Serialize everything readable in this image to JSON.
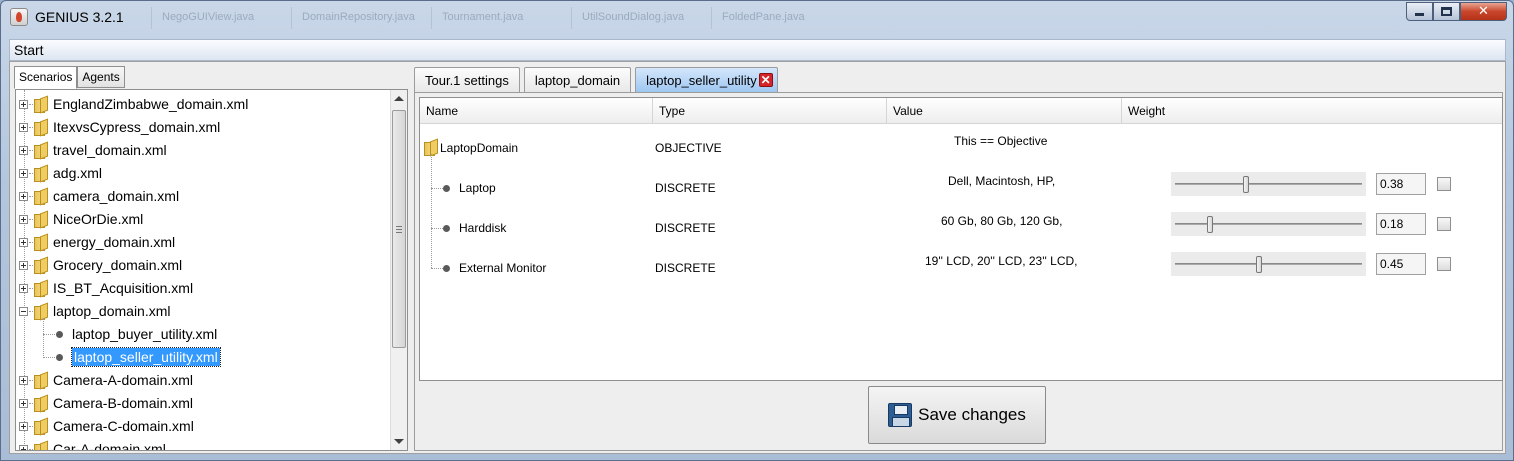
{
  "window": {
    "title": "GENIUS 3.2.1",
    "background_tabs": [
      "NegoGUIView.java",
      "DomainRepository.java",
      "Tournament.java",
      "UtilSoundDialog.java",
      "FoldedPane.java"
    ],
    "buttons": {
      "minimize": "minimize-icon",
      "maximize": "maximize-icon",
      "close": "✕"
    }
  },
  "menubar": {
    "start": "Start"
  },
  "left": {
    "tabs": [
      "Scenarios",
      "Agents"
    ],
    "active_tab": "Scenarios",
    "tree": [
      {
        "label": "EnglandZimbabwe_domain.xml",
        "expanded": false
      },
      {
        "label": "ItexvsCypress_domain.xml",
        "expanded": false
      },
      {
        "label": "travel_domain.xml",
        "expanded": false
      },
      {
        "label": "adg.xml",
        "expanded": false
      },
      {
        "label": "camera_domain.xml",
        "expanded": false
      },
      {
        "label": "NiceOrDie.xml",
        "expanded": false
      },
      {
        "label": "energy_domain.xml",
        "expanded": false
      },
      {
        "label": "Grocery_domain.xml",
        "expanded": false
      },
      {
        "label": "IS_BT_Acquisition.xml",
        "expanded": false
      },
      {
        "label": "laptop_domain.xml",
        "expanded": true
      },
      {
        "label": "laptop_buyer_utility.xml",
        "child": true
      },
      {
        "label": "laptop_seller_utility.xml",
        "child": true,
        "selected": true
      },
      {
        "label": "Camera-A-domain.xml",
        "expanded": false
      },
      {
        "label": "Camera-B-domain.xml",
        "expanded": false
      },
      {
        "label": "Camera-C-domain.xml",
        "expanded": false
      },
      {
        "label": "Car-A-domain.xml",
        "expanded": false
      }
    ]
  },
  "right": {
    "tabs": [
      "Tour.1 settings",
      "laptop_domain",
      "laptop_seller_utility"
    ],
    "active_tab": "laptop_seller_utility",
    "table": {
      "headers": [
        "Name",
        "Type",
        "Value",
        "Weight"
      ],
      "root": {
        "name": "LaptopDomain",
        "type": "OBJECTIVE",
        "value": "This == Objective"
      },
      "issues": [
        {
          "name": "Laptop",
          "type": "DISCRETE",
          "value": "Dell, Macintosh, HP,",
          "weight": "0.38",
          "weight_fraction": 0.38
        },
        {
          "name": "Harddisk",
          "type": "DISCRETE",
          "value": "60 Gb, 80 Gb, 120 Gb,",
          "weight": "0.18",
          "weight_fraction": 0.18
        },
        {
          "name": "External Monitor",
          "type": "DISCRETE",
          "value": "19'' LCD, 20'' LCD, 23'' LCD,",
          "weight": "0.45",
          "weight_fraction": 0.45
        }
      ]
    },
    "save_button": "Save changes"
  },
  "colors": {
    "selection": "#3399ff",
    "active_tab": "#9ec7f1",
    "close_tab": "#d4242a"
  }
}
